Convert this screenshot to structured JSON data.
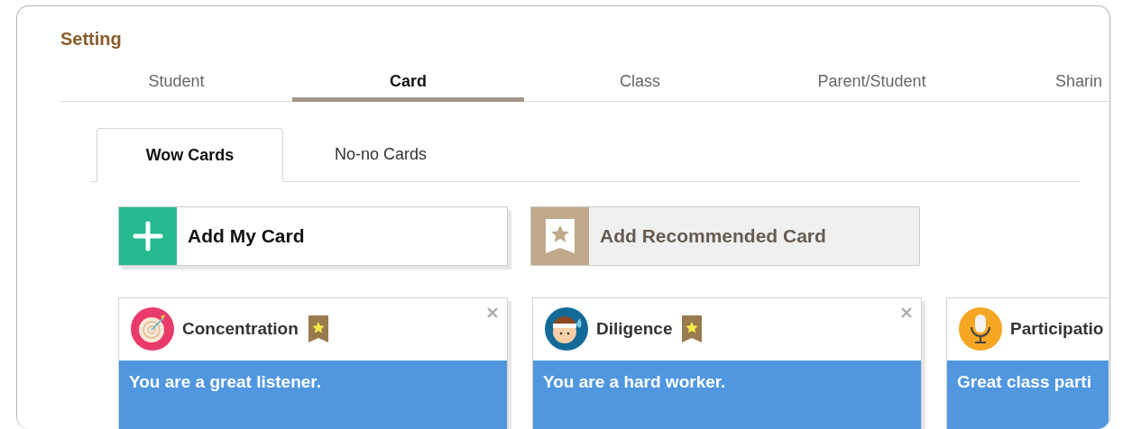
{
  "title": "Setting",
  "tabs": [
    {
      "label": "Student",
      "selected": false
    },
    {
      "label": "Card",
      "selected": true
    },
    {
      "label": "Class",
      "selected": false
    },
    {
      "label": "Parent/Student",
      "selected": false
    },
    {
      "label": "Sharin",
      "selected": false
    }
  ],
  "subtabs": [
    {
      "label": "Wow Cards",
      "selected": true
    },
    {
      "label": "No-no Cards",
      "selected": false
    }
  ],
  "actions": [
    {
      "kind": "add",
      "label": "Add My Card"
    },
    {
      "kind": "recommended",
      "label": "Add Recommended Card"
    }
  ],
  "cards": [
    {
      "kind": "target",
      "title": "Concentration",
      "recommended": true,
      "closable": true,
      "message": "You are a great listener."
    },
    {
      "kind": "headband",
      "title": "Diligence",
      "recommended": true,
      "closable": true,
      "message": "You are a hard worker."
    },
    {
      "kind": "microphone",
      "title": "Participatio",
      "message": "Great class parti"
    }
  ]
}
